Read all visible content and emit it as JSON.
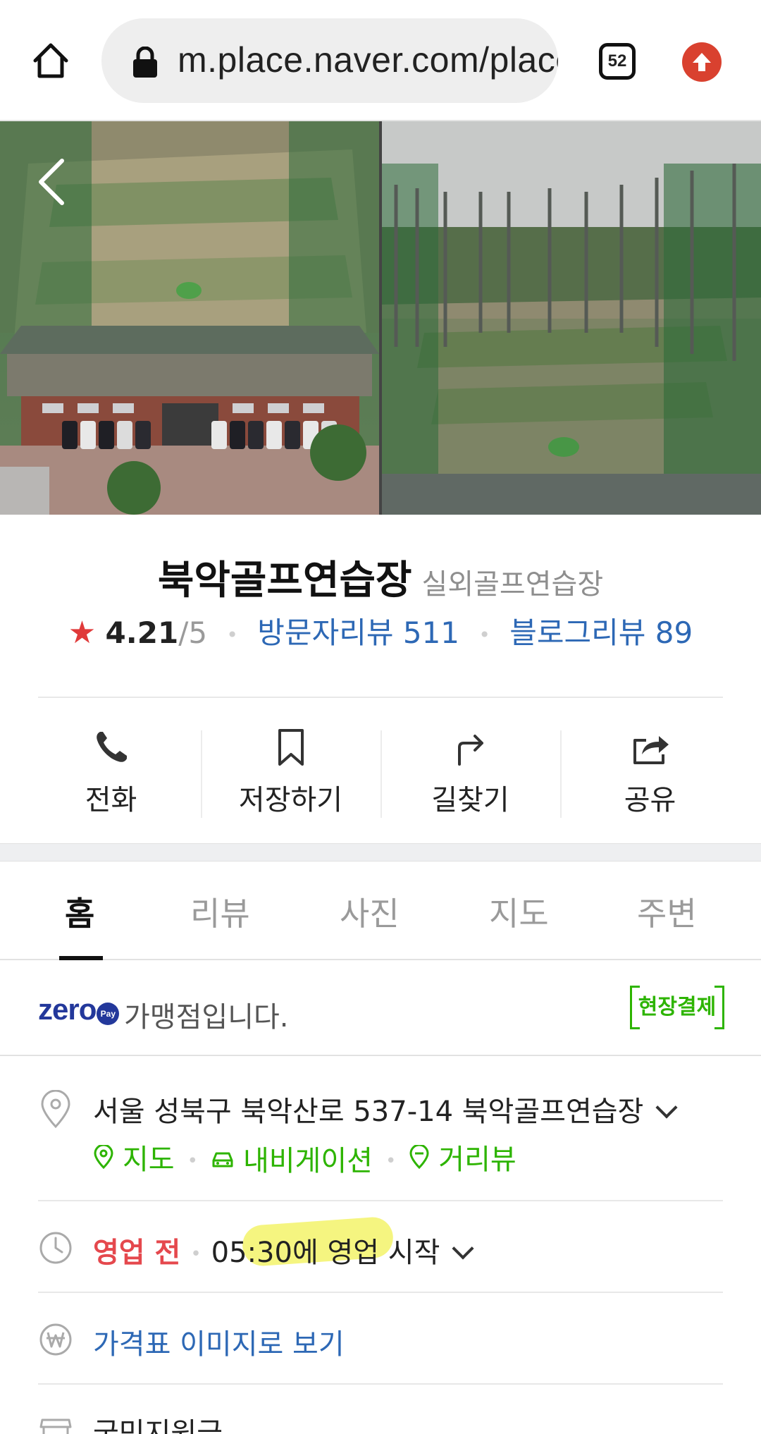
{
  "browser": {
    "url": "m.place.naver.com/place",
    "tab_count": "52"
  },
  "place": {
    "name": "북악골프연습장",
    "category": "실외골프연습장",
    "rating": "4.21",
    "rating_max": "/5",
    "visitor_reviews_label": "방문자리뷰 511",
    "blog_reviews_label": "블로그리뷰 89"
  },
  "actions": [
    {
      "label": "전화"
    },
    {
      "label": "저장하기"
    },
    {
      "label": "길찾기"
    },
    {
      "label": "공유"
    }
  ],
  "tabs": [
    {
      "label": "홈",
      "active": true
    },
    {
      "label": "리뷰"
    },
    {
      "label": "사진"
    },
    {
      "label": "지도"
    },
    {
      "label": "주변"
    }
  ],
  "zero_pay": {
    "logo": "zero",
    "logo_badge": "Pay",
    "text": "가맹점입니다.",
    "onsite_label": "현장결제"
  },
  "address": {
    "text": "서울 성북구 북악산로 537-14 북악골프연습장",
    "links": [
      "지도",
      "내비게이션",
      "거리뷰"
    ]
  },
  "hours": {
    "status": "영업 전",
    "detail": "05:30에 영업 시작"
  },
  "price_link": "가격표 이미지로 보기",
  "support_text": "국민지원금",
  "colors": {
    "accent_green": "#2db400",
    "link_blue": "#2d68b5",
    "status_red": "#e5484d",
    "star_red": "#e03a3a",
    "zeropay_navy": "#23389b"
  }
}
